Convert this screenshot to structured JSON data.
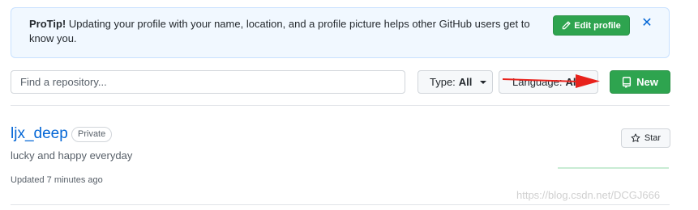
{
  "protip": {
    "label": "ProTip!",
    "message": " Updating your profile with your name, location, and a profile picture helps other GitHub users get to know you.",
    "edit_button": "Edit profile",
    "close_icon": "close-icon"
  },
  "filters": {
    "search_placeholder": "Find a repository...",
    "type_label": "Type:",
    "type_value": "All",
    "language_label": "Language:",
    "language_value": "All",
    "new_button": "New"
  },
  "repo": {
    "name": "ljx_deep",
    "visibility": "Private",
    "description": "lucky and happy everyday",
    "updated": "Updated 7 minutes ago",
    "star_button": "Star"
  },
  "watermark": "https://blog.csdn.net/DCGJ666",
  "colors": {
    "primary_green": "#2ea44f",
    "link_blue": "#0366d6",
    "annotation_red": "#e8221c"
  }
}
